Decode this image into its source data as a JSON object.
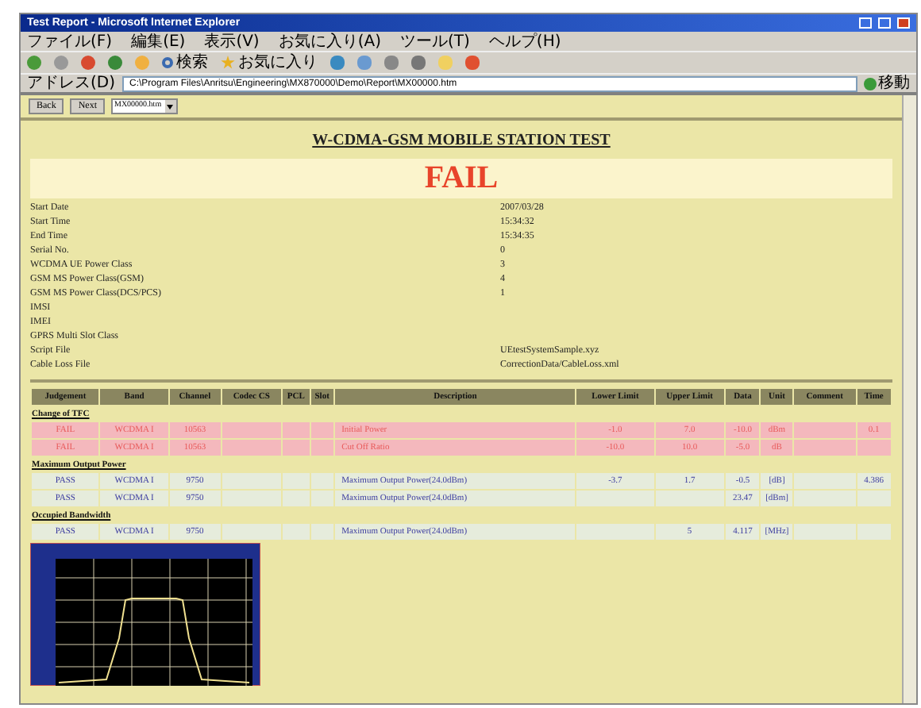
{
  "window": {
    "title": "Test Report - Microsoft Internet Explorer"
  },
  "menu": [
    "ファイル(F)",
    "編集(E)",
    "表示(V)",
    "お気に入り(A)",
    "ツール(T)",
    "ヘルプ(H)"
  ],
  "toolbar": {
    "search": "検索",
    "favorites": "お気に入り"
  },
  "address": {
    "label": "アドレス(D)",
    "value": "C:\\Program Files\\Anritsu\\Engineering\\MX870000\\Demo\\Report\\MX00000.htm",
    "go": "移動"
  },
  "nav": {
    "back": "Back",
    "next": "Next",
    "select": "MX00000.htm"
  },
  "report": {
    "title": "W-CDMA-GSM MOBILE STATION TEST",
    "result": "FAIL",
    "info": [
      {
        "label": "Start Date",
        "value": "2007/03/28"
      },
      {
        "label": "Start Time",
        "value": "15:34:32"
      },
      {
        "label": "End Time",
        "value": "15:34:35"
      },
      {
        "label": "Serial No.",
        "value": "0"
      },
      {
        "label": "WCDMA UE Power Class",
        "value": "3"
      },
      {
        "label": "GSM MS Power Class(GSM)",
        "value": "4"
      },
      {
        "label": "GSM MS Power Class(DCS/PCS)",
        "value": "1"
      },
      {
        "label": "IMSI"
      },
      {
        "label": "IMEI"
      },
      {
        "label": "GPRS Multi Slot Class"
      },
      {
        "label": "Script File",
        "value": "UEtestSystemSample.xyz"
      },
      {
        "label": "Cable Loss File",
        "value": "CorrectionData/CableLoss.xml"
      }
    ],
    "table": {
      "columns": [
        "Judgement",
        "Band",
        "Channel",
        "Codec CS",
        "PCL",
        "Slot",
        "Description",
        "Lower Limit",
        "Upper Limit",
        "Data",
        "Unit",
        "Comment",
        "Time"
      ],
      "rows": [
        {
          "kind": "section",
          "title": "Change of TFC"
        },
        {
          "kind": "fail",
          "cells": [
            "FAIL",
            "WCDMA I",
            "10563",
            "",
            "",
            "",
            "Initial Power",
            "-1.0",
            "7.0",
            "-10.0",
            "dBm",
            "",
            "0.1"
          ]
        },
        {
          "kind": "fail",
          "cells": [
            "FAIL",
            "WCDMA I",
            "10563",
            "",
            "",
            "",
            "Cut Off Ratio",
            "-10.0",
            "10.0",
            "-5.0",
            "dB",
            "",
            ""
          ]
        },
        {
          "kind": "section",
          "title": "Maximum Output Power"
        },
        {
          "kind": "pass",
          "cells": [
            "PASS",
            "WCDMA I",
            "9750",
            "",
            "",
            "",
            "Maximum Output Power(24.0dBm)",
            "-3.7",
            "1.7",
            "-0.5",
            "[dB]",
            "",
            "4.386"
          ]
        },
        {
          "kind": "pass",
          "cells": [
            "PASS",
            "WCDMA I",
            "9750",
            "",
            "",
            "",
            "Maximum Output Power(24.0dBm)",
            "",
            "",
            "23.47",
            "[dBm]",
            "",
            ""
          ]
        },
        {
          "kind": "section",
          "title": "Occupied Bandwidth"
        },
        {
          "kind": "pass",
          "cells": [
            "PASS",
            "WCDMA I",
            "9750",
            "",
            "",
            "",
            "Maximum Output Power(24.0dBm)",
            "",
            "5",
            "4.117",
            "[MHz]",
            "",
            ""
          ]
        }
      ]
    }
  }
}
